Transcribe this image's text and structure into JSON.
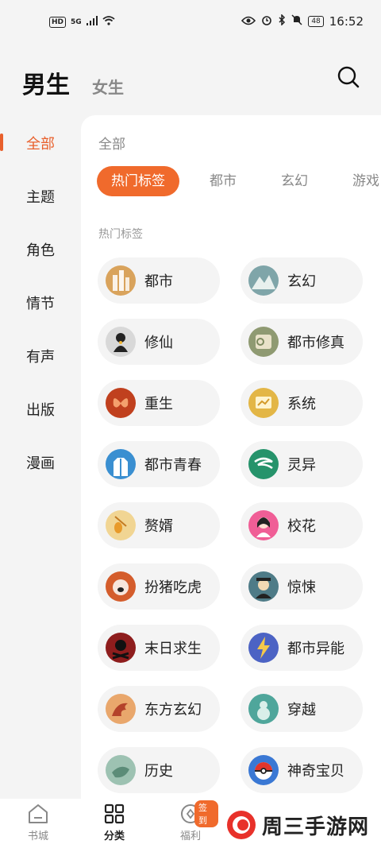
{
  "status_bar": {
    "hd": "HD",
    "network": "5G",
    "battery": "48",
    "time": "16:52"
  },
  "header": {
    "tab_male": "男生",
    "tab_female": "女生"
  },
  "rail": {
    "items": [
      "全部",
      "主题",
      "角色",
      "情节",
      "有声",
      "出版",
      "漫画"
    ]
  },
  "panel": {
    "title": "全部",
    "chips": [
      "热门标签",
      "都市",
      "玄幻",
      "游戏"
    ],
    "section_label": "热门标签",
    "tags": [
      {
        "label": "都市",
        "icon": "city-buildings-icon",
        "color": "#d9a35c"
      },
      {
        "label": "玄幻",
        "icon": "misty-mountains-icon",
        "color": "#7fa5a9"
      },
      {
        "label": "修仙",
        "icon": "immortal-figure-icon",
        "color": "#d8d8d8"
      },
      {
        "label": "都市修真",
        "icon": "scroll-icon",
        "color": "#8f9a72"
      },
      {
        "label": "重生",
        "icon": "butterfly-icon",
        "color": "#c0401e"
      },
      {
        "label": "系统",
        "icon": "screen-icon",
        "color": "#e3b646"
      },
      {
        "label": "都市青春",
        "icon": "jacket-icon",
        "color": "#3a8fd1"
      },
      {
        "label": "灵异",
        "icon": "swirl-icon",
        "color": "#26936b"
      },
      {
        "label": "赘婿",
        "icon": "lantern-icon",
        "color": "#f1d593"
      },
      {
        "label": "校花",
        "icon": "girl-icon",
        "color": "#f05e96"
      },
      {
        "label": "扮猪吃虎",
        "icon": "pig-icon",
        "color": "#d45d2c"
      },
      {
        "label": "惊悚",
        "icon": "official-portrait-icon",
        "color": "#4e7b87"
      },
      {
        "label": "末日求生",
        "icon": "skull-icon",
        "color": "#8e1d1d"
      },
      {
        "label": "都市异能",
        "icon": "lightning-icon",
        "color": "#4c63c4"
      },
      {
        "label": "东方玄幻",
        "icon": "dragon-icon",
        "color": "#e9a76c"
      },
      {
        "label": "穿越",
        "icon": "gourd-icon",
        "color": "#4fa69b"
      },
      {
        "label": "历史",
        "icon": "jade-icon",
        "color": "#9dc2b2"
      },
      {
        "label": "神奇宝贝",
        "icon": "pokeball-icon",
        "color": "#3a78d4"
      }
    ]
  },
  "bottom_nav": {
    "items": [
      "书城",
      "分类",
      "福利"
    ],
    "badge": "签到"
  },
  "watermark": {
    "text": "周三手游网"
  },
  "colors": {
    "accent": "#f06a2c",
    "panel_bg": "#ffffff",
    "page_bg": "#f4f4f4"
  }
}
